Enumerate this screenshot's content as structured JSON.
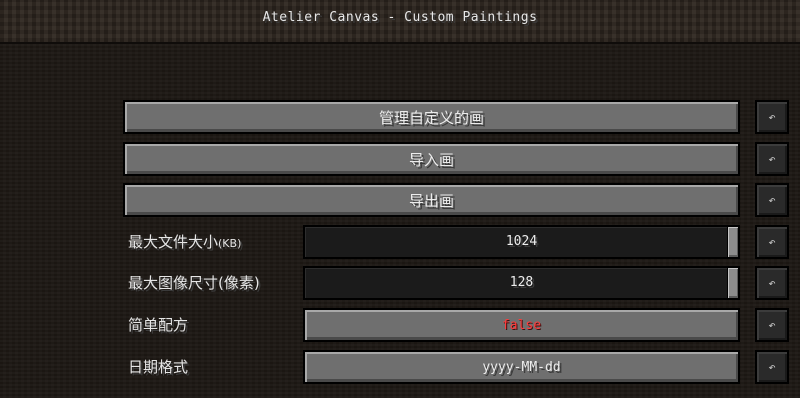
{
  "window": {
    "title": "Atelier Canvas - Custom Paintings"
  },
  "rows": [
    {
      "label": "管理自定义的画",
      "reset_icon": "↶"
    },
    {
      "label": "导入画",
      "reset_icon": "↶"
    },
    {
      "label": "导出画",
      "reset_icon": "↶"
    },
    {
      "label": "最大文件大小",
      "label_unit": "(KB)",
      "value": "1024",
      "reset_icon": "↶"
    },
    {
      "label": "最大图像尺寸",
      "label_unit": "(像素)",
      "value": "128",
      "reset_icon": "↶"
    },
    {
      "label": "简单配方",
      "value": "false",
      "value_color": "#ff3b3b",
      "reset_icon": "↶"
    },
    {
      "label": "日期格式",
      "value": "yyyy-MM-dd",
      "reset_icon": "↶"
    }
  ],
  "icons": {
    "reset": "undo-arrow-icon"
  }
}
